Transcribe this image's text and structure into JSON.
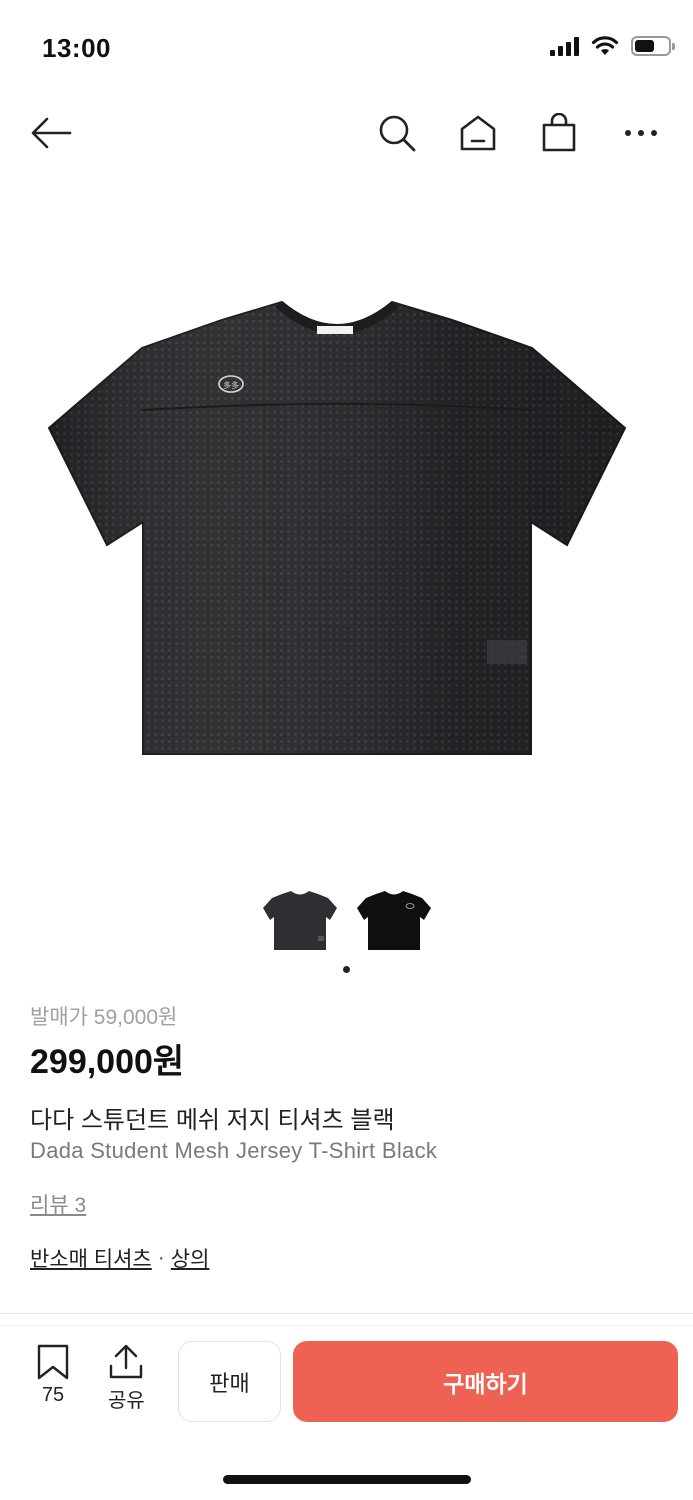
{
  "status_bar": {
    "time": "13:00",
    "battery_level": 0.6
  },
  "nav": {
    "icons": [
      "back-arrow-icon",
      "search-icon",
      "home-icon",
      "shopping-bag-icon",
      "more-icon"
    ]
  },
  "product": {
    "logo_text": "多多",
    "image_count": 2,
    "current_image": 1,
    "release_price_label": "발매가 59,000원",
    "price": "299,000원",
    "title_ko": "다다 스튜던트 메쉬 저지 티셔츠 블랙",
    "title_en": "Dada Student Mesh Jersey T-Shirt Black",
    "review_link": "리뷰 3",
    "categories": [
      "반소매 티셔츠",
      "상의"
    ],
    "category_separator": "·"
  },
  "bottom_bar": {
    "bookmark_count": "75",
    "share_label": "공유",
    "sell_label": "판매",
    "buy_label": "구매하기"
  },
  "colors": {
    "buy_button": "#ef6253",
    "shirt": "#232326",
    "muted_text": "#a0a0a0"
  }
}
